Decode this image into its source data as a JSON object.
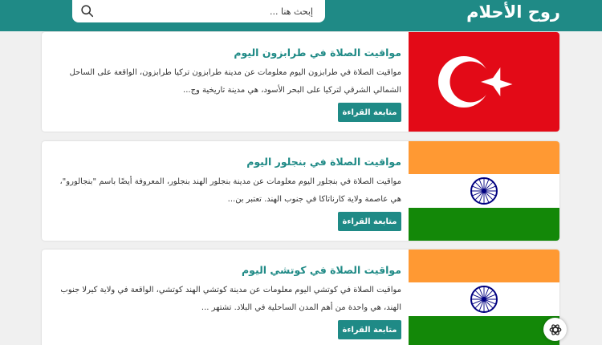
{
  "header": {
    "logo": "روح الأحلام",
    "search_placeholder": "إبحث هنا ...",
    "brand_color": "#1f8a86"
  },
  "posts": [
    {
      "title": "مواقيت الصلاة في طرابزون اليوم",
      "excerpt": "مواقيت الصلاة في طرابزون اليوم معلومات عن مدينة طرابزون تركيا طرابزون، الواقعة على الساحل الشمالي الشرقي لتركيا على البحر الأسود، هي مدينة تاريخية وج...",
      "button": "متابعة القراءة",
      "image": "turkey-flag"
    },
    {
      "title": "مواقيت الصلاة في بنجلور اليوم",
      "excerpt": "مواقيت الصلاة في بنجلور اليوم معلومات عن مدينة بنجلور الهند بنجلور، المعروفة أيضًا باسم \"بنجالورو\"، هي عاصمة ولاية كارناتاكا في جنوب الهند. تعتبر بن...",
      "button": "متابعة القراءة",
      "image": "india-flag"
    },
    {
      "title": "مواقيت الصلاة في كوتشي اليوم",
      "excerpt": "مواقيت الصلاة في كوتشي اليوم معلومات عن مدينة كوتشي الهند كوتشي، الواقعة في ولاية كيرلا جنوب الهند، هي واحدة من أهم المدن الساحلية في البلاد. تشتهر ...",
      "button": "متابعة القراءة",
      "image": "india-flag"
    }
  ],
  "floating_button": {
    "icon": "chatgpt-icon"
  }
}
